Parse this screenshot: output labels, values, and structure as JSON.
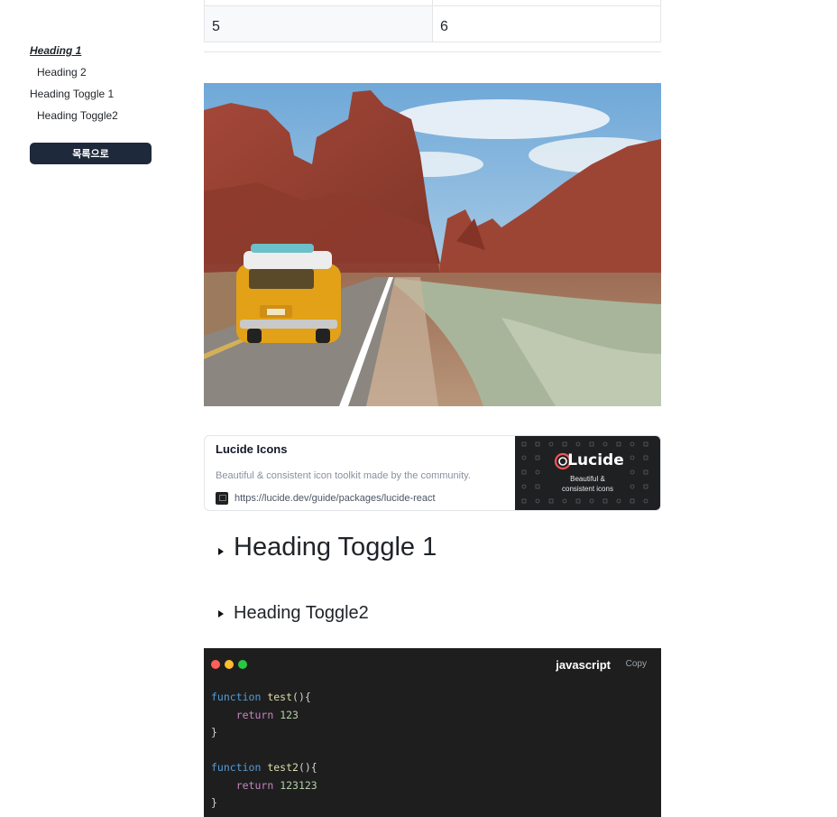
{
  "toc": {
    "items": [
      {
        "label": "Heading 1",
        "active": true
      },
      {
        "label": "Heading 2"
      },
      {
        "label": "Heading Toggle 1"
      },
      {
        "label": "Heading Toggle2"
      }
    ],
    "back_button": "목록으로"
  },
  "table": {
    "row": [
      "5",
      "6"
    ]
  },
  "bookmark": {
    "title": "Lucide Icons",
    "description": "Beautiful & consistent icon toolkit made by the community.",
    "url": "https://lucide.dev/guide/packages/lucide-react",
    "thumb_title": "Lucide",
    "thumb_subtitle_1": "Beautiful &",
    "thumb_subtitle_2": "consistent icons"
  },
  "toggles": {
    "toggle1": "Heading Toggle 1",
    "toggle2": "Heading Toggle2"
  },
  "code": {
    "language": "javascript",
    "copy_label": "Copy",
    "dot_colors": [
      "#ff5f57",
      "#febc2e",
      "#28c840"
    ],
    "fn1": {
      "keyword": "function",
      "name": "test",
      "parens": "(){",
      "ret": "return",
      "value": "123",
      "close": "}"
    },
    "fn2": {
      "keyword": "function",
      "name": "test2",
      "parens": "(){",
      "ret": "return",
      "value": "123123",
      "close": "}"
    }
  }
}
